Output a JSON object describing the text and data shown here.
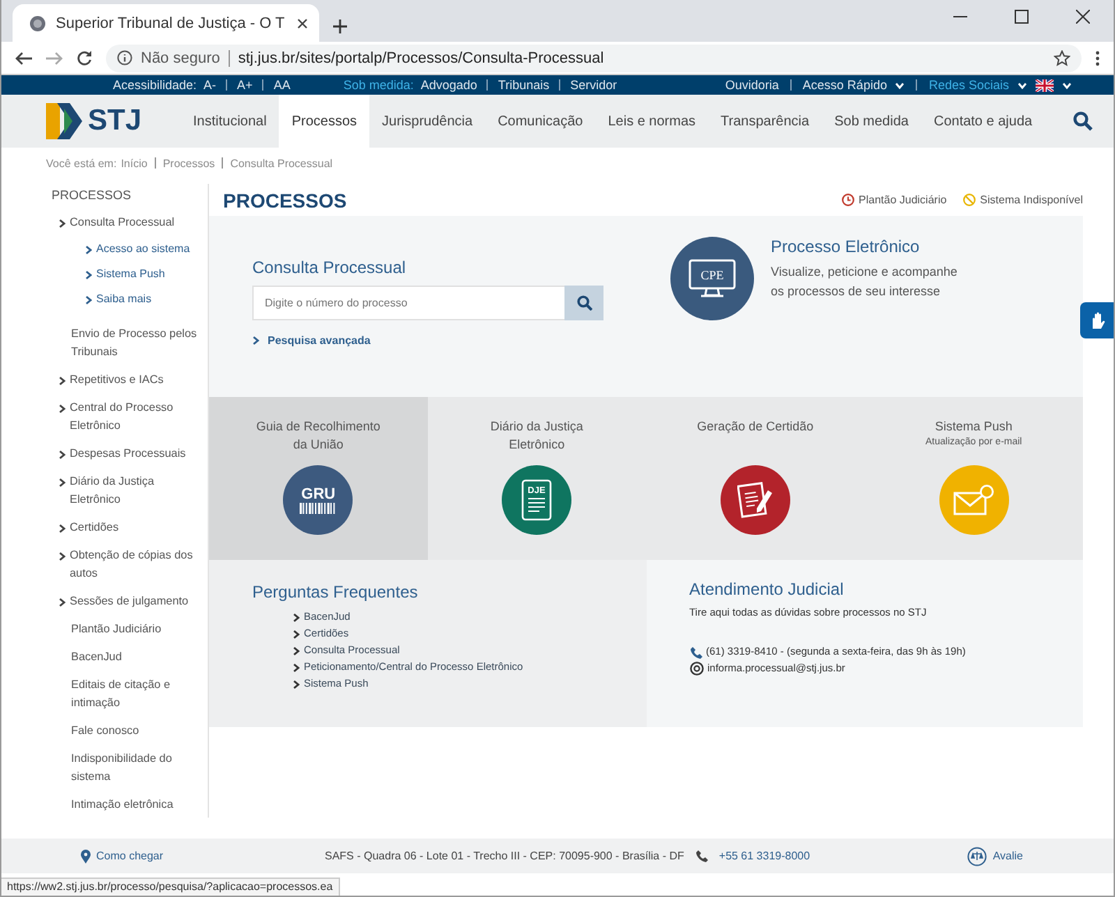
{
  "browser": {
    "tab_title": "Superior Tribunal de Justiça - O T",
    "security": "Não seguro",
    "url": "stj.jus.br/sites/portalp/Processos/Consulta-Processual"
  },
  "top_bar": {
    "accessibility_label": "Acessibilidade:",
    "accessibility_links": [
      "A-",
      "A+",
      "AA"
    ],
    "audience_label": "Sob medida:",
    "audience_links": [
      "Advogado",
      "Tribunais",
      "Servidor"
    ],
    "right_links": [
      {
        "label": "Ouvidoria",
        "kind": "plain"
      },
      {
        "label": "Acesso Rápido",
        "kind": "dropdown"
      },
      {
        "label": "Redes Sociais",
        "kind": "accent"
      }
    ]
  },
  "logo": {
    "text": "STJ"
  },
  "nav": [
    {
      "label": "Institucional",
      "selected": false
    },
    {
      "label": "Processos",
      "selected": true
    },
    {
      "label": "Jurisprudência",
      "selected": false
    },
    {
      "label": "Comunicação",
      "selected": false
    },
    {
      "label": "Leis e normas",
      "selected": false
    },
    {
      "label": "Transparência",
      "selected": false
    },
    {
      "label": "Sob medida",
      "selected": false
    },
    {
      "label": "Contato e ajuda",
      "selected": false
    }
  ],
  "breadcrumb": {
    "label": "Você está em:",
    "items": [
      "Início",
      "Processos",
      "Consulta Processual"
    ]
  },
  "sidebar": {
    "heading": "PROCESSOS",
    "items": [
      {
        "label": "Consulta Processual",
        "kind": "chevron",
        "children": [
          {
            "label": "Acesso ao sistema"
          },
          {
            "label": "Sistema Push"
          },
          {
            "label": "Saiba mais"
          }
        ]
      },
      {
        "label": "Envio de Processo pelos Tribunais",
        "kind": "plain"
      },
      {
        "label": "Repetitivos e IACs",
        "kind": "chevron"
      },
      {
        "label": "Central do Processo Eletrônico",
        "kind": "chevron"
      },
      {
        "label": "Despesas Processuais",
        "kind": "chevron"
      },
      {
        "label": "Diário da Justiça Eletrônico",
        "kind": "chevron"
      },
      {
        "label": "Certidões",
        "kind": "chevron"
      },
      {
        "label": "Obtenção de cópias dos autos",
        "kind": "chevron"
      },
      {
        "label": "Sessões de julgamento",
        "kind": "chevron"
      },
      {
        "label": "Plantão Judiciário",
        "kind": "plain"
      },
      {
        "label": "BacenJud",
        "kind": "plain"
      },
      {
        "label": "Editais de citação e intimação",
        "kind": "plain"
      },
      {
        "label": "Fale conosco",
        "kind": "plain"
      },
      {
        "label": "Indisponibilidade do sistema",
        "kind": "plain"
      },
      {
        "label": "Intimação eletrônica",
        "kind": "plain"
      }
    ]
  },
  "page_title": "PROCESSOS",
  "notices": [
    {
      "label": "Plantão Judiciário",
      "kind": "clock"
    },
    {
      "label": "Sistema Indisponível",
      "kind": "blocked"
    }
  ],
  "search": {
    "title": "Consulta Processual",
    "placeholder": "Digite o número do processo",
    "advanced_link": "Pesquisa avançada"
  },
  "electronic": {
    "badge": "CPE",
    "title": "Processo Eletrônico",
    "description": "Visualize, peticione e acompanhe os processos de seu interesse"
  },
  "services": [
    {
      "title": "Guia de Recolhimento da União",
      "kind": "gru",
      "badge": "GRU",
      "color": "#3d5a7f",
      "selected": true
    },
    {
      "title": "Diário da Justiça Eletrônico",
      "kind": "dje",
      "badge": "DJE",
      "color": "#0f7560",
      "selected": false
    },
    {
      "title": "Geração de Certidão",
      "kind": "certificate",
      "color": "#b3232b",
      "selected": false
    },
    {
      "title": "Sistema Push",
      "subtitle": "Atualização por e-mail",
      "kind": "mail",
      "color": "#f0b200",
      "selected": false
    }
  ],
  "faq": {
    "title": "Perguntas Frequentes",
    "items": [
      "BacenJud",
      "Certidões",
      "Consulta Processual",
      "Peticionamento/Central do Processo Eletrônico",
      "Sistema Push"
    ]
  },
  "support": {
    "title": "Atendimento Judicial",
    "intro": "Tire aqui todas as dúvidas sobre processos no STJ",
    "phone": "(61) 3319-8410 - (segunda a sexta-feira, das 9h às 19h)",
    "email": "informa.processual@stj.jus.br"
  },
  "footer": {
    "directions": "Como chegar",
    "address": "SAFS - Quadra 06 - Lote 01 - Trecho III - CEP: 70095-900 - Brasília - DF",
    "phone": "+55 61 3319-8000",
    "rate": "Avalie"
  },
  "status_url": "https://ww2.stj.jus.br/processo/pesquisa/?aplicacao=processos.ea"
}
